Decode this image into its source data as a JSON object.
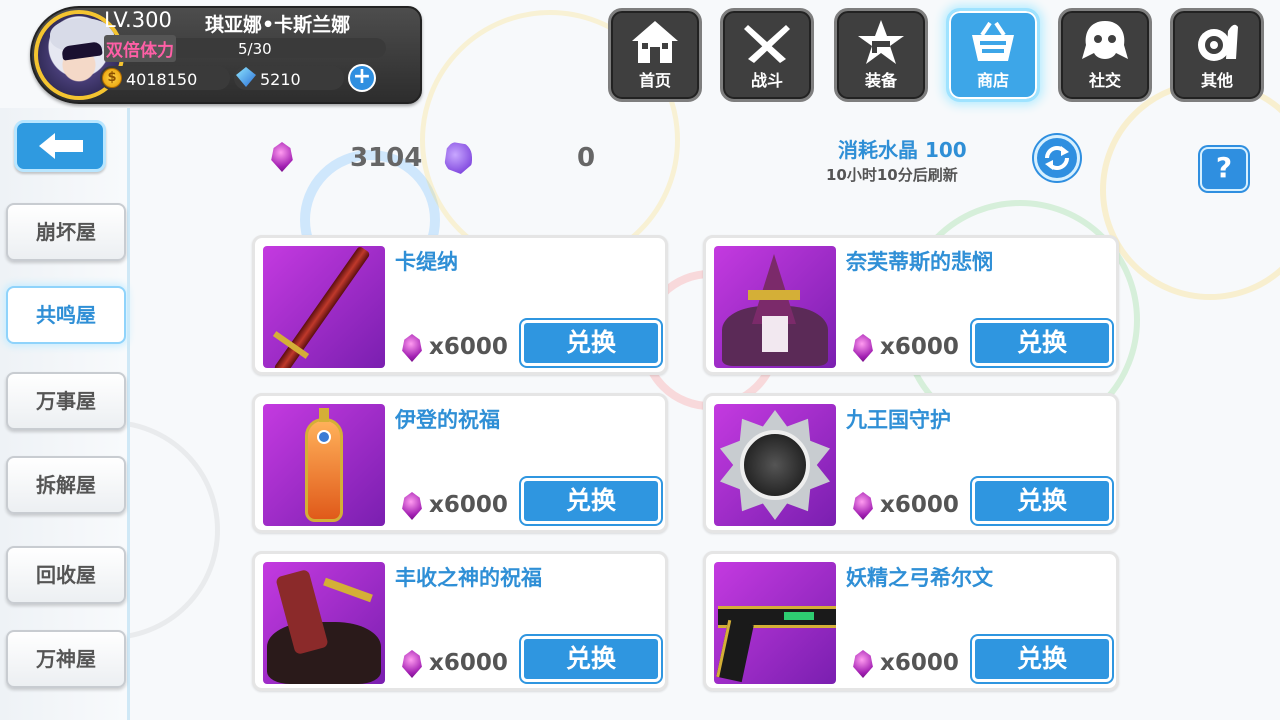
{
  "player": {
    "level": "LV.300",
    "name": "琪亚娜•卡斯兰娜",
    "stamina_label": "双倍体力",
    "stamina": "5/30",
    "stamina_fraction": 0.167,
    "gold": "4018150",
    "gold_symbol": "$",
    "gems": "5210",
    "add_symbol": "+"
  },
  "nav": {
    "home": "首页",
    "battle": "战斗",
    "equip": "装备",
    "shop": "商店",
    "social": "社交",
    "other": "其他",
    "active": "shop"
  },
  "sidebar": {
    "items": [
      "崩坏屋",
      "共鸣屋",
      "万事屋",
      "拆解屋",
      "回收屋",
      "万神屋"
    ],
    "active_index": 1
  },
  "resources": {
    "crystal": "3104",
    "swirl": "0",
    "consume": "消耗水晶 100",
    "refresh_time": "10小时10分后刷新",
    "help": "?"
  },
  "items": [
    {
      "name": "卡缇纳",
      "price": "x6000",
      "button": "兑换",
      "icon": "sword-icon"
    },
    {
      "name": "奈芙蒂斯的悲悯",
      "price": "x6000",
      "button": "兑换",
      "icon": "witch-hat-icon"
    },
    {
      "name": "伊登的祝福",
      "price": "x6000",
      "button": "兑换",
      "icon": "lantern-icon"
    },
    {
      "name": "九王国守护",
      "price": "x6000",
      "button": "兑换",
      "icon": "medal-tree-icon"
    },
    {
      "name": "丰收之神的祝福",
      "price": "x6000",
      "button": "兑换",
      "icon": "skirt-icon"
    },
    {
      "name": "妖精之弓希尔文",
      "price": "x6000",
      "button": "兑换",
      "icon": "pistol-icon"
    }
  ],
  "colors": {
    "accent": "#2f8fd6",
    "button": "#2f96e0",
    "item_bg": "#9a2cc8",
    "stamina_pink": "#ff5fa6"
  }
}
